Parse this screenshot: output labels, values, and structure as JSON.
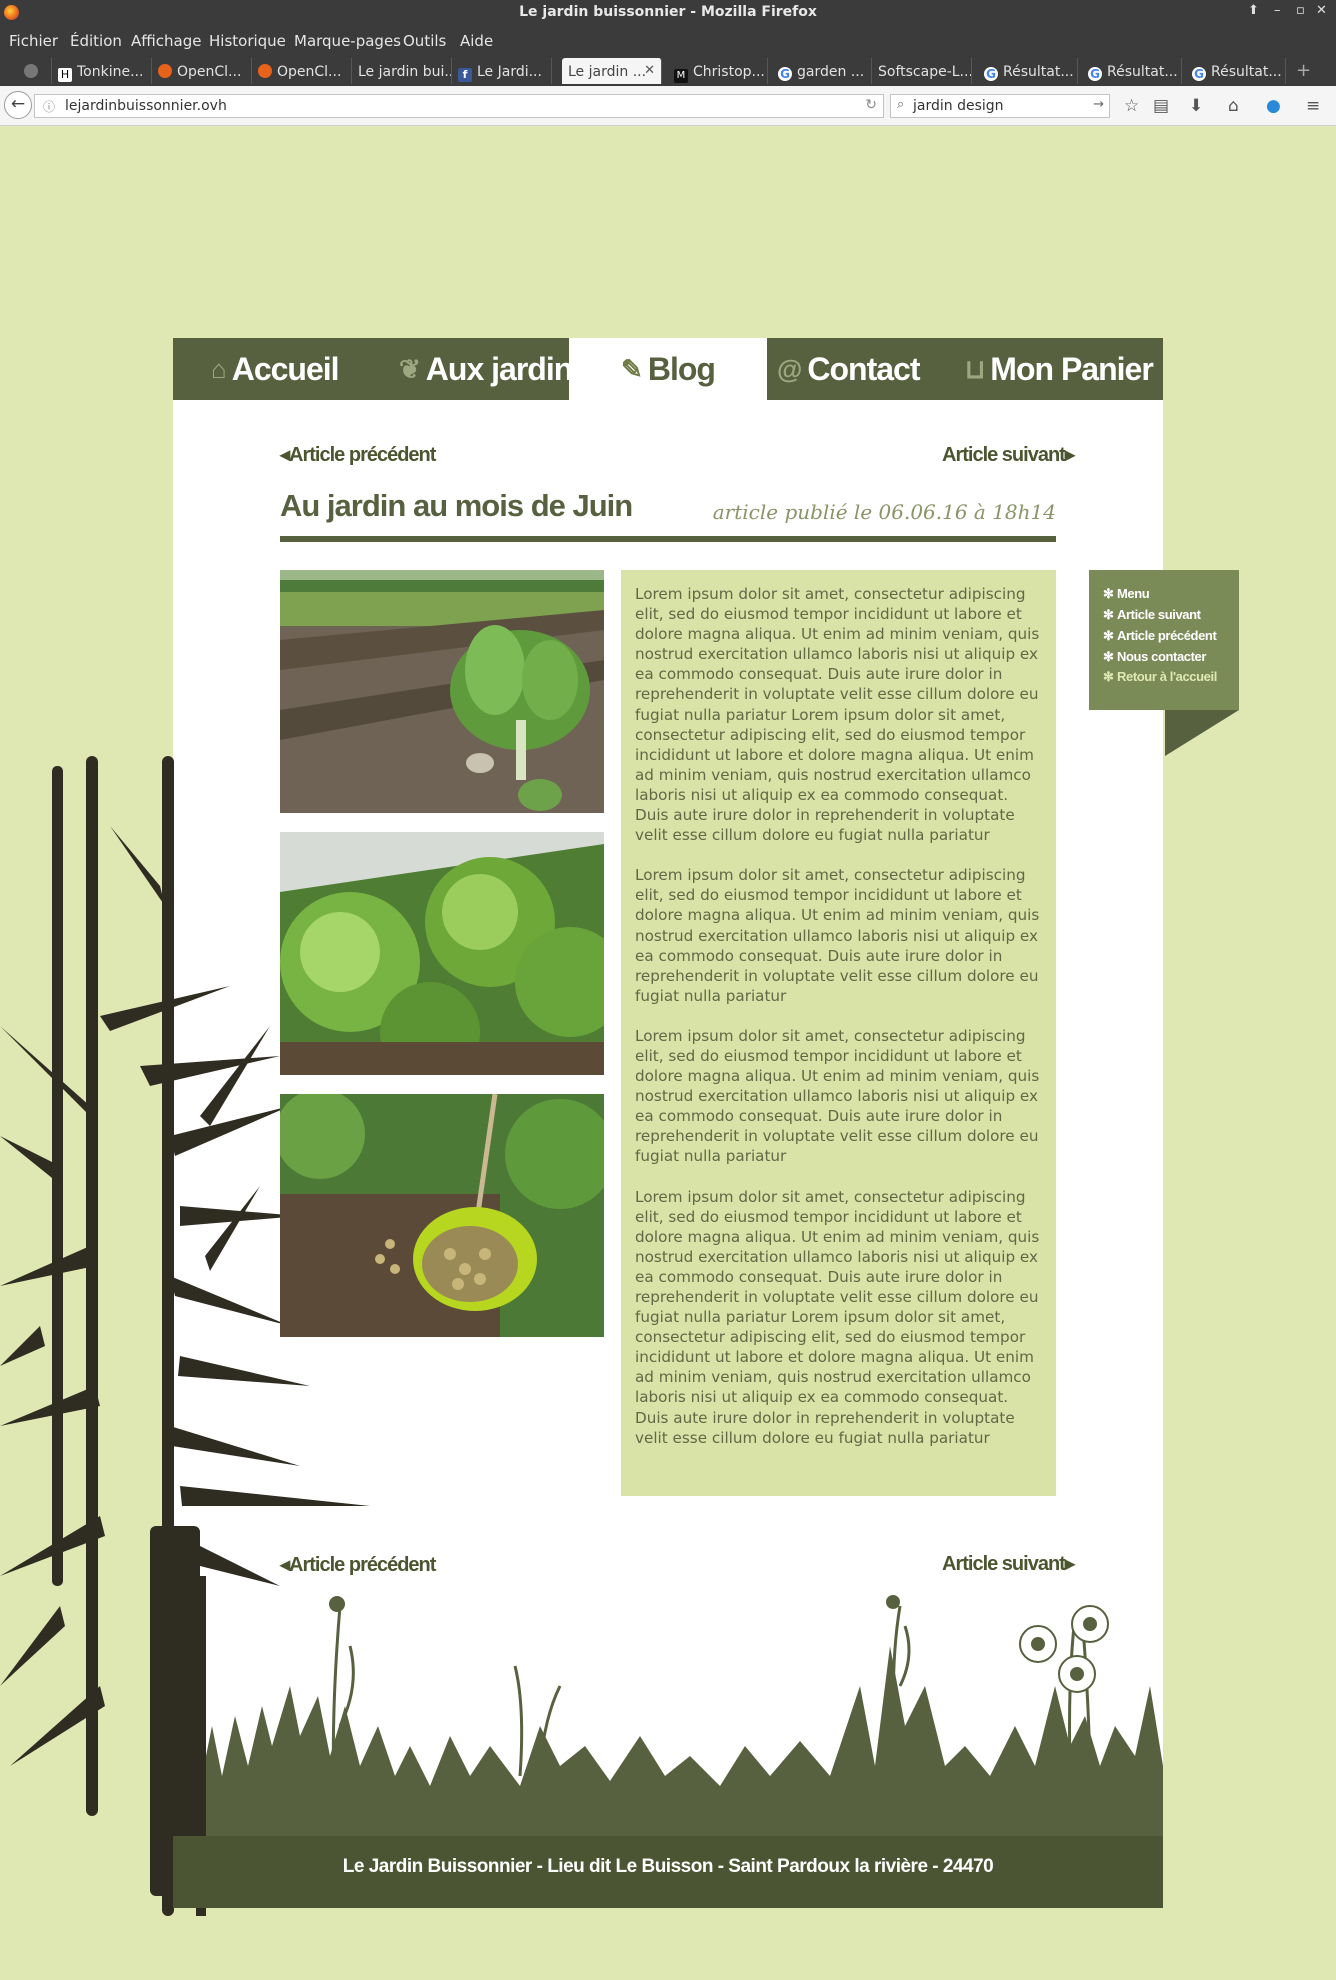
{
  "browser": {
    "window_title": "Le jardin buissonnier - Mozilla Firefox",
    "menu": [
      "Fichier",
      "Édition",
      "Affichage",
      "Historique",
      "Marque-pages",
      "Outils",
      "Aide"
    ],
    "tabs": [
      {
        "label": "Tonkine...",
        "icon": "h-icon",
        "color": "#ffffff"
      },
      {
        "label": "OpenCl...",
        "icon": "openclassrooms-icon",
        "color": "#e8631a"
      },
      {
        "label": "OpenCl...",
        "icon": "openclassrooms-icon",
        "color": "#e8631a"
      },
      {
        "label": "Le jardin bui...",
        "icon": "none",
        "color": ""
      },
      {
        "label": "Le Jardi...",
        "icon": "facebook-icon",
        "color": "#3b5998"
      },
      {
        "label": "Le jardin ...",
        "icon": "none",
        "color": "",
        "active": true
      },
      {
        "label": "Christop...",
        "icon": "medium-icon",
        "color": "#111111"
      },
      {
        "label": "garden ...",
        "icon": "google-icon",
        "color": "#4285f4"
      },
      {
        "label": "Softscape-L...",
        "icon": "none",
        "color": ""
      },
      {
        "label": "Résultat...",
        "icon": "google-icon",
        "color": "#4285f4"
      },
      {
        "label": "Résultat...",
        "icon": "google-icon",
        "color": "#4285f4"
      },
      {
        "label": "Résultat...",
        "icon": "google-icon",
        "color": "#4285f4"
      }
    ],
    "url": "lejardinbuissonnier.ovh",
    "search_value": "jardin design"
  },
  "site": {
    "colors": {
      "olive_dark": "#57613f",
      "background": "#dfe8b3",
      "text_box": "#d9e3a8",
      "side_menu": "#7b8b57"
    },
    "nav": [
      {
        "label": "Accueil",
        "icon": "barn-icon"
      },
      {
        "label": "Aux jardins",
        "icon": "sprout-icon"
      },
      {
        "label": "Blog",
        "icon": "quill-icon",
        "active": true
      },
      {
        "label": "Contact",
        "icon": "at-icon"
      },
      {
        "label": "Mon Panier",
        "icon": "basket-icon"
      }
    ],
    "article_prev": "Article précédent",
    "article_next": "Article suivant",
    "article_title": "Au jardin au mois de Juin",
    "article_date": "article publié le 06.06.16 à 18h14",
    "photos": [
      {
        "alt": "chard plants in a field",
        "icon": "photo-icon"
      },
      {
        "alt": "lettuce heads",
        "icon": "photo-icon"
      },
      {
        "alt": "harvested potatoes in a green basket",
        "icon": "photo-icon"
      }
    ],
    "paragraphs": [
      "Lorem ipsum dolor sit amet, consectetur adipiscing elit, sed do eiusmod tempor incididunt ut labore et dolore magna aliqua. Ut enim ad minim veniam, quis nostrud exercitation ullamco laboris nisi ut aliquip ex ea commodo consequat. Duis aute irure dolor in reprehenderit in voluptate velit esse cillum dolore eu fugiat nulla pariatur Lorem ipsum dolor sit amet, consectetur adipiscing elit, sed do eiusmod tempor incididunt ut labore et dolore magna aliqua. Ut enim ad minim veniam, quis nostrud exercitation ullamco laboris nisi ut aliquip ex ea commodo consequat. Duis aute irure dolor in reprehenderit in voluptate velit esse cillum dolore eu fugiat nulla pariatur",
      "Lorem ipsum dolor sit amet, consectetur adipiscing elit, sed do eiusmod tempor incididunt ut labore et dolore magna aliqua. Ut enim ad minim veniam, quis nostrud exercitation ullamco laboris nisi ut aliquip ex ea commodo consequat. Duis aute irure dolor in reprehenderit in voluptate velit esse cillum dolore eu fugiat nulla pariatur",
      "Lorem ipsum dolor sit amet, consectetur adipiscing elit, sed do eiusmod tempor incididunt ut labore et dolore magna aliqua. Ut enim ad minim veniam, quis nostrud exercitation ullamco laboris nisi ut aliquip ex ea commodo consequat. Duis aute irure dolor in reprehenderit in voluptate velit esse cillum dolore eu fugiat nulla pariatur",
      "Lorem ipsum dolor sit amet, consectetur adipiscing elit, sed do eiusmod tempor incididunt ut labore et dolore magna aliqua. Ut enim ad minim veniam, quis nostrud exercitation ullamco laboris nisi ut aliquip ex ea commodo consequat. Duis aute irure dolor in reprehenderit in voluptate velit esse cillum dolore eu fugiat nulla pariatur Lorem ipsum dolor sit amet, consectetur adipiscing elit, sed do eiusmod tempor incididunt ut labore et dolore magna aliqua. Ut enim ad minim veniam, quis nostrud exercitation ullamco laboris nisi ut aliquip ex ea commodo consequat. Duis aute irure dolor in reprehenderit in voluptate velit esse cillum dolore eu fugiat nulla pariatur"
    ],
    "side_menu": [
      {
        "label": "Menu",
        "icon": "flower-icon"
      },
      {
        "label": "Article suivant",
        "icon": "flower-icon"
      },
      {
        "label": "Article précédent",
        "icon": "flower-icon"
      },
      {
        "label": "Nous contacter",
        "icon": "flower-icon"
      },
      {
        "label": "Retour à l'accueil",
        "icon": "flower-icon",
        "dim": true
      }
    ],
    "footer": "Le Jardin Buissonnier - Lieu dit Le Buisson - Saint Pardoux la rivière - 24470"
  }
}
